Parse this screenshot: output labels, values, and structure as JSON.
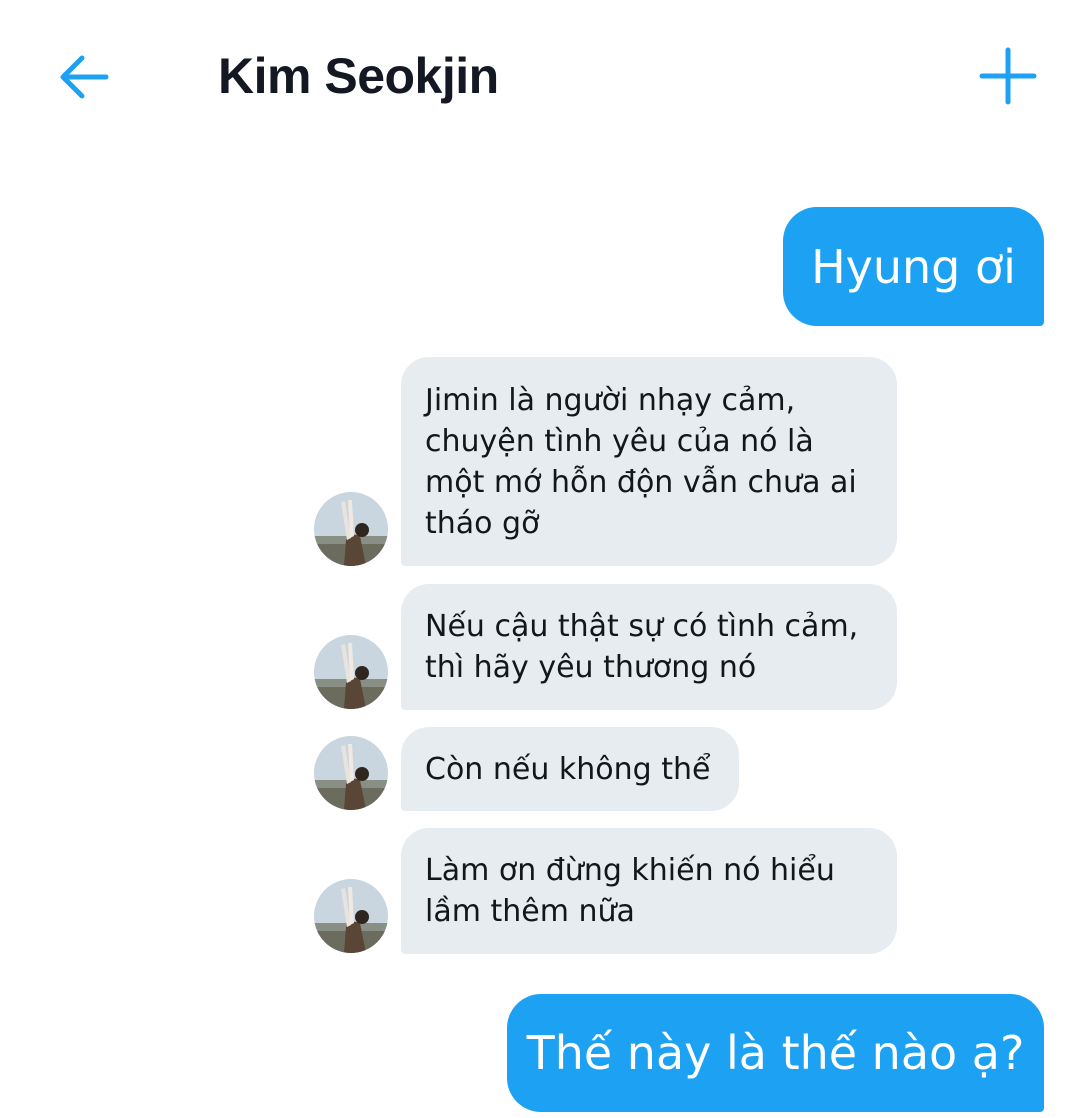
{
  "header": {
    "title": "Kim Seokjin",
    "back_icon": "arrow-left-icon",
    "add_icon": "plus-icon"
  },
  "colors": {
    "accent": "#1da1f2",
    "incoming_bubble": "#e6ecf0",
    "title_text": "#141823"
  },
  "messages": [
    {
      "direction": "out",
      "text": "Hyung ơi"
    },
    {
      "direction": "in",
      "text": "Jimin là người nhạy cảm, chuyện tình yêu của nó là một mớ hỗn độn vẫn chưa ai tháo gỡ"
    },
    {
      "direction": "in",
      "text": "Nếu cậu thật sự có tình cảm, thì hãy yêu thương nó"
    },
    {
      "direction": "in",
      "text": "Còn nếu không thể"
    },
    {
      "direction": "in",
      "text": "Làm ơn đừng khiến nó hiểu lầm thêm nữa"
    },
    {
      "direction": "out",
      "text": "Thế này là thế nào ạ?"
    }
  ]
}
